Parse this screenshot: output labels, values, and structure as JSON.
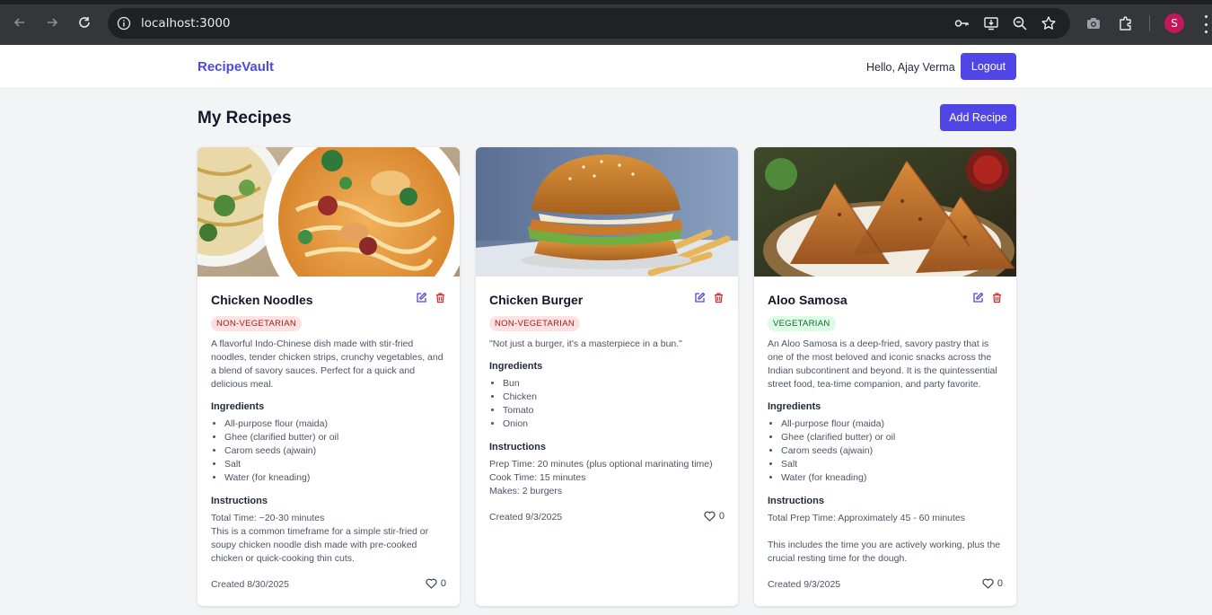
{
  "browser": {
    "url": "localhost:3000",
    "profile_initial": "S"
  },
  "app": {
    "brand": "RecipeVault",
    "greeting": "Hello, Ajay Verma",
    "logout_label": "Logout",
    "page_title": "My Recipes",
    "add_recipe_label": "Add Recipe"
  },
  "labels": {
    "ingredients": "Ingredients",
    "instructions": "Instructions"
  },
  "recipes": [
    {
      "title": "Chicken Noodles",
      "category": "NON-VEGETARIAN",
      "description": "A flavorful Indo-Chinese dish made with stir-fried noodles, tender chicken strips, crunchy vegetables, and a blend of savory sauces. Perfect for a quick and delicious meal.",
      "ingredients": [
        "All-purpose flour (maida)",
        "Ghee (clarified butter) or oil",
        "Carom seeds (ajwain)",
        "Salt",
        "Water (for kneading)"
      ],
      "instructions": "Total Time: ~20-30 minutes\nThis is a common timeframe for a simple stir-fried or soupy chicken noodle dish made with pre-cooked chicken or quick-cooking thin cuts.",
      "created": "Created 8/30/2025",
      "likes": "0"
    },
    {
      "title": "Chicken Burger",
      "category": "NON-VEGETARIAN",
      "description": "\"Not just a burger, it's a masterpiece in a bun.\"",
      "ingredients": [
        "Bun",
        "Chicken",
        "Tomato",
        "Onion"
      ],
      "instructions": "Prep Time: 20 minutes (plus optional marinating time)\nCook Time: 15 minutes\nMakes: 2 burgers",
      "created": "Created 9/3/2025",
      "likes": "0"
    },
    {
      "title": "Aloo Samosa",
      "category": "VEGETARIAN",
      "description": "An Aloo Samosa is a deep-fried, savory pastry that is one of the most beloved and iconic snacks across the Indian subcontinent and beyond. It is the quintessential street food, tea-time companion, and party favorite.",
      "ingredients": [
        "All-purpose flour (maida)",
        "Ghee (clarified butter) or oil",
        "Carom seeds (ajwain)",
        "Salt",
        "Water (for kneading)"
      ],
      "instructions": "Total Prep Time: Approximately 45 - 60 minutes\n\nThis includes the time you are actively working, plus the crucial resting time for the dough.",
      "created": "Created 9/3/2025",
      "likes": "0"
    }
  ],
  "colors": {
    "brand": "#4f46e5",
    "nonveg_badge_bg": "#fee2e2",
    "veg_badge_bg": "#dcfce7",
    "delete": "#dc2626"
  }
}
